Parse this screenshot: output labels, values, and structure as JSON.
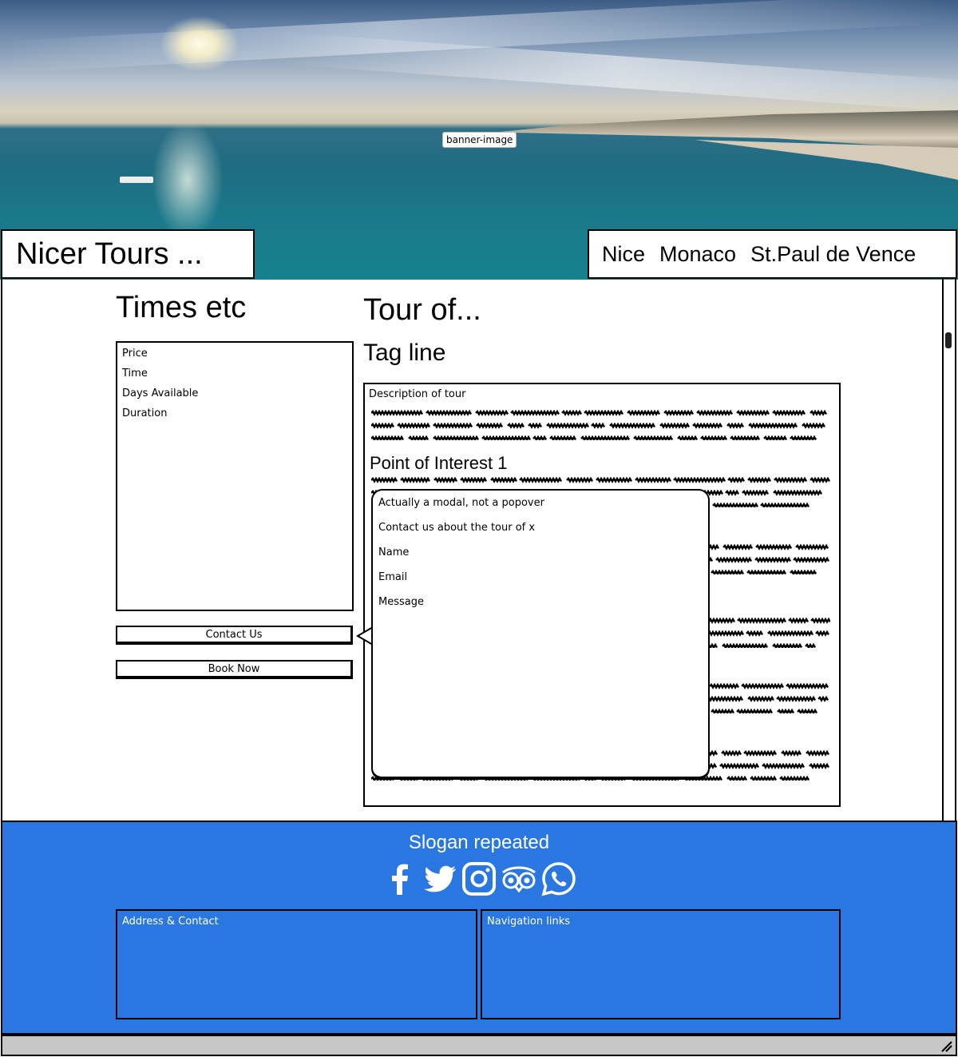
{
  "banner": {
    "label": "banner-image"
  },
  "header": {
    "logo": "Nicer Tours  ...",
    "nav": [
      "Nice",
      "Monaco",
      "St.Paul de Vence"
    ]
  },
  "sidebar": {
    "heading": "Times etc",
    "info": [
      "Price",
      "Time",
      "Days Available",
      "Duration"
    ],
    "contact_label": "Contact Us",
    "book_label": "Book Now"
  },
  "main": {
    "heading": "Tour of...",
    "tagline": "Tag line",
    "description_label": "Description of tour",
    "poi_heading": "Point of Interest 1"
  },
  "modal": {
    "lines": [
      "Actually a modal, not a popover",
      "Contact us about the tour of x",
      "Name",
      "Email",
      "Message"
    ]
  },
  "footer": {
    "slogan": "Slogan repeated",
    "social": [
      "facebook-icon",
      "twitter-icon",
      "instagram-icon",
      "tripadvisor-icon",
      "whatsapp-icon"
    ],
    "address_label": "Address & Contact",
    "nav_label": "Navigation links",
    "color": "#2b77e2"
  }
}
